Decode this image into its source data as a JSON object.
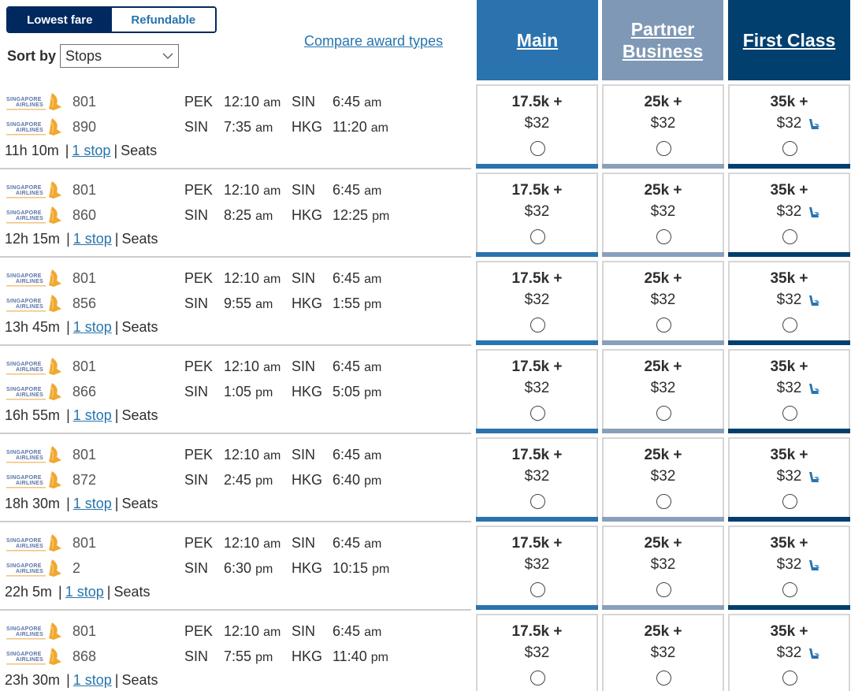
{
  "toolbar": {
    "fare_options": [
      {
        "label": "Lowest fare",
        "active": true
      },
      {
        "label": "Refundable",
        "active": false
      }
    ],
    "sort_label": "Sort by",
    "sort_value": "Stops",
    "compare_link": "Compare award types"
  },
  "columns": {
    "main": {
      "label": "Main",
      "color": "#2a73ae"
    },
    "partner": {
      "label_line1": "Partner",
      "label_line2": "Business",
      "color": "#7f98b6"
    },
    "first": {
      "label": "First Class",
      "color": "#003f6e"
    }
  },
  "airline": "Singapore Airlines",
  "flights": [
    {
      "segments": [
        {
          "flight": "801",
          "from": "PEK",
          "dep_time": "12:10",
          "dep_ampm": "am",
          "to": "SIN",
          "arr_time": "6:45",
          "arr_ampm": "am"
        },
        {
          "flight": "890",
          "from": "SIN",
          "dep_time": "7:35",
          "dep_ampm": "am",
          "to": "HKG",
          "arr_time": "11:20",
          "arr_ampm": "am"
        }
      ],
      "duration": "11h 10m",
      "stops": "1 stop",
      "seats": "Seats",
      "fares": {
        "main": {
          "miles": "17.5k +",
          "price": "$32"
        },
        "partner": {
          "miles": "25k +",
          "price": "$32"
        },
        "first": {
          "miles": "35k +",
          "price": "$32"
        }
      }
    },
    {
      "segments": [
        {
          "flight": "801",
          "from": "PEK",
          "dep_time": "12:10",
          "dep_ampm": "am",
          "to": "SIN",
          "arr_time": "6:45",
          "arr_ampm": "am"
        },
        {
          "flight": "860",
          "from": "SIN",
          "dep_time": "8:25",
          "dep_ampm": "am",
          "to": "HKG",
          "arr_time": "12:25",
          "arr_ampm": "pm"
        }
      ],
      "duration": "12h 15m",
      "stops": "1 stop",
      "seats": "Seats",
      "fares": {
        "main": {
          "miles": "17.5k +",
          "price": "$32"
        },
        "partner": {
          "miles": "25k +",
          "price": "$32"
        },
        "first": {
          "miles": "35k +",
          "price": "$32"
        }
      }
    },
    {
      "segments": [
        {
          "flight": "801",
          "from": "PEK",
          "dep_time": "12:10",
          "dep_ampm": "am",
          "to": "SIN",
          "arr_time": "6:45",
          "arr_ampm": "am"
        },
        {
          "flight": "856",
          "from": "SIN",
          "dep_time": "9:55",
          "dep_ampm": "am",
          "to": "HKG",
          "arr_time": "1:55",
          "arr_ampm": "pm"
        }
      ],
      "duration": "13h 45m",
      "stops": "1 stop",
      "seats": "Seats",
      "fares": {
        "main": {
          "miles": "17.5k +",
          "price": "$32"
        },
        "partner": {
          "miles": "25k +",
          "price": "$32"
        },
        "first": {
          "miles": "35k +",
          "price": "$32"
        }
      }
    },
    {
      "segments": [
        {
          "flight": "801",
          "from": "PEK",
          "dep_time": "12:10",
          "dep_ampm": "am",
          "to": "SIN",
          "arr_time": "6:45",
          "arr_ampm": "am"
        },
        {
          "flight": "866",
          "from": "SIN",
          "dep_time": "1:05",
          "dep_ampm": "pm",
          "to": "HKG",
          "arr_time": "5:05",
          "arr_ampm": "pm"
        }
      ],
      "duration": "16h 55m",
      "stops": "1 stop",
      "seats": "Seats",
      "fares": {
        "main": {
          "miles": "17.5k +",
          "price": "$32"
        },
        "partner": {
          "miles": "25k +",
          "price": "$32"
        },
        "first": {
          "miles": "35k +",
          "price": "$32"
        }
      }
    },
    {
      "segments": [
        {
          "flight": "801",
          "from": "PEK",
          "dep_time": "12:10",
          "dep_ampm": "am",
          "to": "SIN",
          "arr_time": "6:45",
          "arr_ampm": "am"
        },
        {
          "flight": "872",
          "from": "SIN",
          "dep_time": "2:45",
          "dep_ampm": "pm",
          "to": "HKG",
          "arr_time": "6:40",
          "arr_ampm": "pm"
        }
      ],
      "duration": "18h 30m",
      "stops": "1 stop",
      "seats": "Seats",
      "fares": {
        "main": {
          "miles": "17.5k +",
          "price": "$32"
        },
        "partner": {
          "miles": "25k +",
          "price": "$32"
        },
        "first": {
          "miles": "35k +",
          "price": "$32"
        }
      }
    },
    {
      "segments": [
        {
          "flight": "801",
          "from": "PEK",
          "dep_time": "12:10",
          "dep_ampm": "am",
          "to": "SIN",
          "arr_time": "6:45",
          "arr_ampm": "am"
        },
        {
          "flight": "2",
          "from": "SIN",
          "dep_time": "6:30",
          "dep_ampm": "pm",
          "to": "HKG",
          "arr_time": "10:15",
          "arr_ampm": "pm"
        }
      ],
      "duration": "22h 5m",
      "stops": "1 stop",
      "seats": "Seats",
      "fares": {
        "main": {
          "miles": "17.5k +",
          "price": "$32"
        },
        "partner": {
          "miles": "25k +",
          "price": "$32"
        },
        "first": {
          "miles": "35k +",
          "price": "$32"
        }
      }
    },
    {
      "segments": [
        {
          "flight": "801",
          "from": "PEK",
          "dep_time": "12:10",
          "dep_ampm": "am",
          "to": "SIN",
          "arr_time": "6:45",
          "arr_ampm": "am"
        },
        {
          "flight": "868",
          "from": "SIN",
          "dep_time": "7:55",
          "dep_ampm": "pm",
          "to": "HKG",
          "arr_time": "11:40",
          "arr_ampm": "pm"
        }
      ],
      "duration": "23h 30m",
      "stops": "1 stop",
      "seats": "Seats",
      "fares": {
        "main": {
          "miles": "17.5k +",
          "price": "$32"
        },
        "partner": {
          "miles": "25k +",
          "price": "$32"
        },
        "first": {
          "miles": "35k +",
          "price": "$32"
        }
      }
    }
  ]
}
